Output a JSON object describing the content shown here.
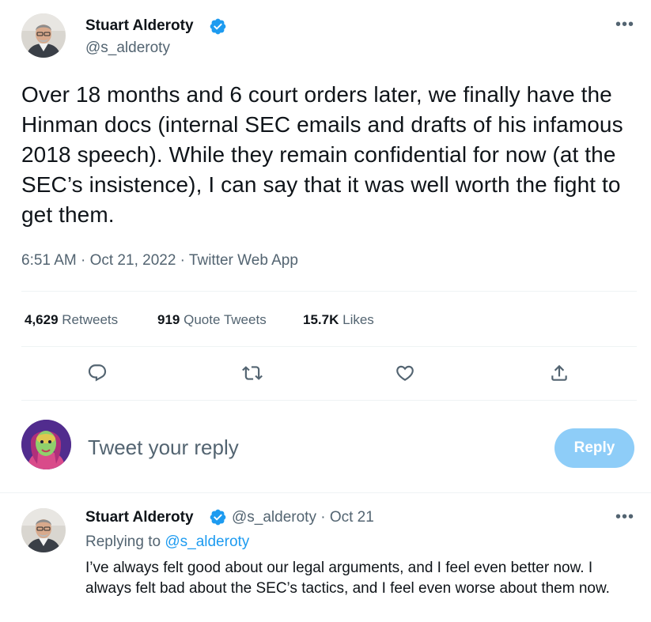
{
  "main_tweet": {
    "author_name": "Stuart Alderoty",
    "author_handle": "@s_alderoty",
    "more_label": "•••",
    "text": "Over 18 months and 6 court orders later, we finally have the Hinman docs (internal SEC emails and drafts of his infamous 2018 speech). While they remain confidential for now (at the SEC’s insistence), I can say that it was well worth the fight to get them.",
    "meta": "6:51 AM · Oct 21, 2022 · Twitter Web App"
  },
  "stats": {
    "retweets_count": "4,629",
    "retweets_label": "Retweets",
    "quotes_count": "919",
    "quotes_label": "Quote Tweets",
    "likes_count": "15.7K",
    "likes_label": "Likes"
  },
  "actions": {
    "icons": [
      "reply-icon",
      "retweet-icon",
      "like-icon",
      "share-icon"
    ]
  },
  "composer": {
    "placeholder": "Tweet your reply",
    "reply_label": "Reply"
  },
  "reply_tweet": {
    "author_name": "Stuart Alderoty",
    "author_handle": "@s_alderoty",
    "separator": "·",
    "date": "Oct 21",
    "more_label": "•••",
    "replying_to_label": "Replying to",
    "replying_to_handle": "@s_alderoty",
    "text": "I’ve always felt good about our legal arguments, and I feel even better now. I always felt bad about the SEC’s tactics, and I feel even worse about them now."
  },
  "colors": {
    "accent": "#1d9bf0",
    "reply_button_disabled": "#8ecdf8",
    "muted_text": "#536471",
    "divider": "#eff3f4"
  }
}
